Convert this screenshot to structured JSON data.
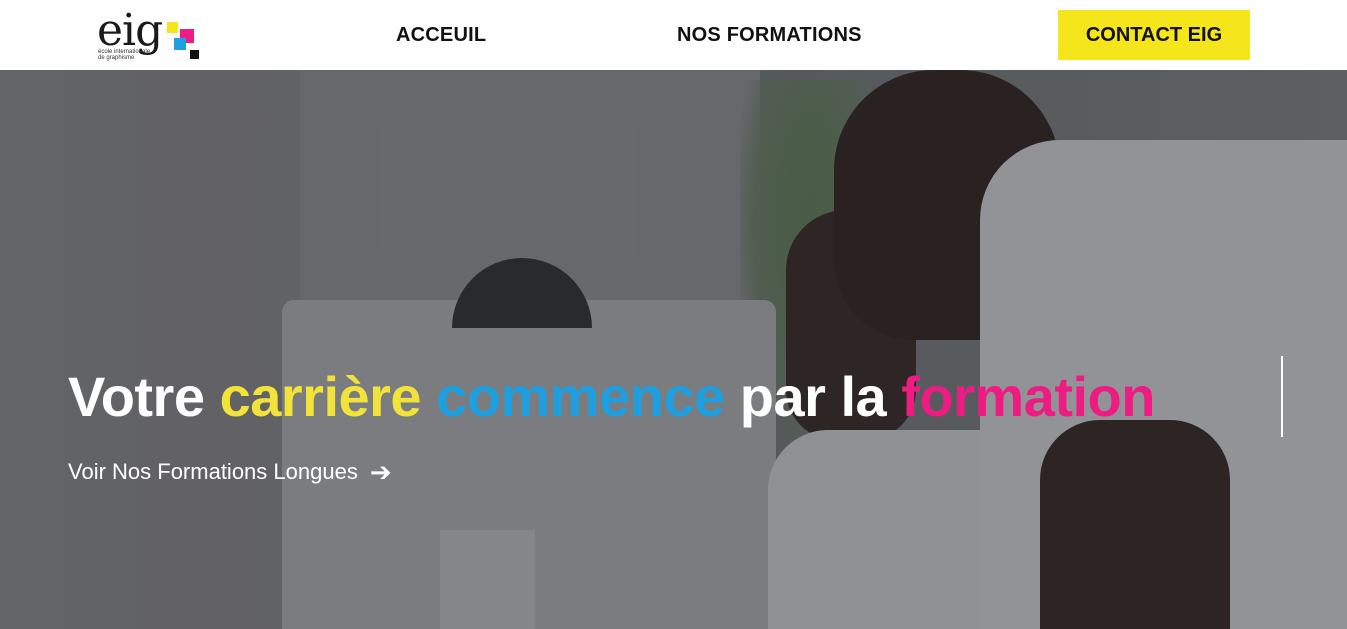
{
  "logo": {
    "word": "eig",
    "tagline": "école internationale de graphisme",
    "colors": [
      "#f5e61c",
      "#ee1b82",
      "#1e9fe0",
      "#111111"
    ]
  },
  "nav": {
    "items": [
      {
        "label": "ACCEUIL"
      },
      {
        "label": "NOS FORMATIONS"
      }
    ],
    "cta_label": "CONTACT EIG",
    "cta_color": "#f5e61c"
  },
  "hero": {
    "headline": {
      "part1": "Votre",
      "part2": "carrière",
      "part3": "commence",
      "part4": "par la",
      "part5": "formation"
    },
    "link_label": "Voir Nos Formations Longues",
    "link_icon": "arrow-right-icon",
    "colors": {
      "yellow": "#f2e33a",
      "blue": "#1e9fe0",
      "pink": "#ee1b82"
    }
  }
}
